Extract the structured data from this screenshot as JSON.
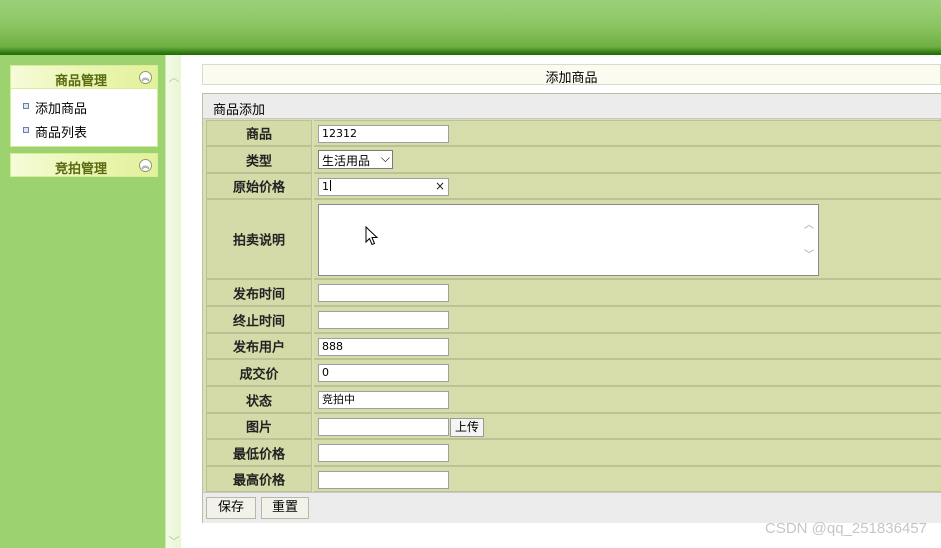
{
  "sidebar": {
    "menus": [
      {
        "title": "商品管理",
        "items": [
          "添加商品",
          "商品列表"
        ]
      },
      {
        "title": "竞拍管理",
        "items": []
      }
    ]
  },
  "page": {
    "title": "添加商品"
  },
  "form": {
    "caption": "商品添加",
    "fields": {
      "name": {
        "label": "商品",
        "value": "12312"
      },
      "type": {
        "label": "类型",
        "value": "生活用品"
      },
      "original_price": {
        "label": "原始价格",
        "value": "1"
      },
      "description": {
        "label": "拍卖说明",
        "value": ""
      },
      "publish_time": {
        "label": "发布时间",
        "value": ""
      },
      "end_time": {
        "label": "终止时间",
        "value": ""
      },
      "publisher": {
        "label": "发布用户",
        "value": "888"
      },
      "deal_price": {
        "label": "成交价",
        "value": "0"
      },
      "status": {
        "label": "状态",
        "value": "竞拍中"
      },
      "image": {
        "label": "图片",
        "value": "",
        "upload_label": "上传"
      },
      "min_price": {
        "label": "最低价格",
        "value": ""
      },
      "max_price": {
        "label": "最高价格",
        "value": ""
      }
    },
    "save_label": "保存",
    "reset_label": "重置"
  },
  "watermark": "CSDN @qq_251836457",
  "icons": {
    "collapse": "double-chevron-up-icon",
    "clear": "close-icon",
    "cursor": "mouse-pointer-icon"
  },
  "colors": {
    "header": "#8cc663",
    "sidebar": "#9dd36f",
    "form_bg": "#d9dfb3"
  }
}
